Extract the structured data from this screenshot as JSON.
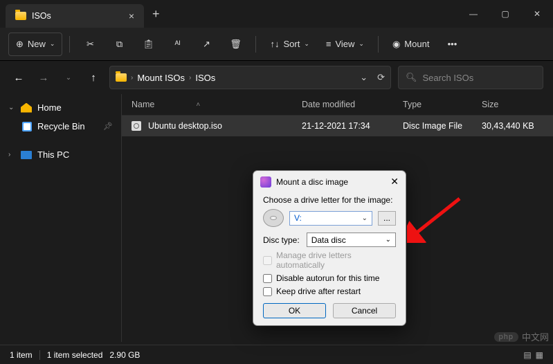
{
  "titlebar": {
    "tab_title": "ISOs"
  },
  "toolbar": {
    "new_label": "New",
    "sort_label": "Sort",
    "view_label": "View",
    "mount_label": "Mount"
  },
  "nav": {
    "crumb1": "Mount ISOs",
    "crumb2": "ISOs",
    "search_placeholder": "Search ISOs"
  },
  "sidebar": {
    "home": "Home",
    "recycle": "Recycle Bin",
    "thispc": "This PC"
  },
  "columns": {
    "name": "Name",
    "date": "Date modified",
    "type": "Type",
    "size": "Size"
  },
  "files": [
    {
      "name": "Ubuntu desktop.iso",
      "date": "21-12-2021 17:34",
      "type": "Disc Image File",
      "size": "30,43,440 KB"
    }
  ],
  "status": {
    "count": "1 item",
    "selected": "1 item selected",
    "size": "2.90 GB"
  },
  "dialog": {
    "title": "Mount a disc image",
    "choose": "Choose a drive letter for the image:",
    "drive": "V:",
    "dots": "...",
    "disctype_label": "Disc type:",
    "disctype_value": "Data disc",
    "chk_manage": "Manage drive letters automatically",
    "chk_autorun": "Disable autorun for this time",
    "chk_keep": "Keep drive after restart",
    "ok": "OK",
    "cancel": "Cancel"
  },
  "watermark": {
    "logo": "php",
    "text": "中文网"
  }
}
